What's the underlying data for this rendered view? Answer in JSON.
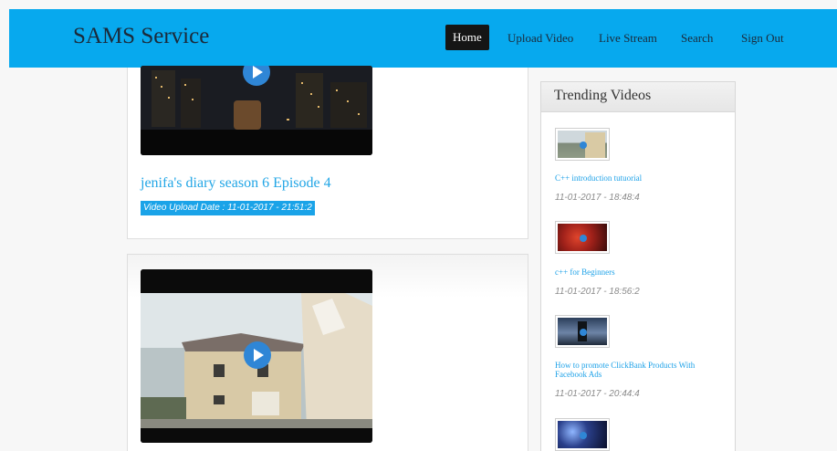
{
  "navbar": {
    "brand": "SAMS Service",
    "items": [
      {
        "label": "Home",
        "active": true
      },
      {
        "label": "Upload Video",
        "active": false
      },
      {
        "label": "Live Stream",
        "active": false
      },
      {
        "label": "Search",
        "active": false
      },
      {
        "label": "Sign Out",
        "active": false
      }
    ],
    "bg_color": "#07a9ee"
  },
  "videos": [
    {
      "title": "jenifa's diary season 6 Episode 4",
      "upload_date": "Video Upload Date : 11-01-2017 - 21:51:2",
      "play_icon": "play-icon"
    },
    {
      "play_icon": "play-icon"
    }
  ],
  "sidebar": {
    "heading": "Trending Videos",
    "items": [
      {
        "title": "C++ introduction tutuorial",
        "date": "11-01-2017 - 18:48:4"
      },
      {
        "title": "c++ for Beginners",
        "date": "11-01-2017 - 18:56:2"
      },
      {
        "title": "How to promote ClickBank Products With Facebook Ads",
        "date": "11-01-2017 - 20:44:4"
      },
      {
        "title": "",
        "date": ""
      }
    ]
  },
  "colors": {
    "accent": "#1aa3e8",
    "link": "#22a6e6",
    "play": "#2f86d6"
  }
}
